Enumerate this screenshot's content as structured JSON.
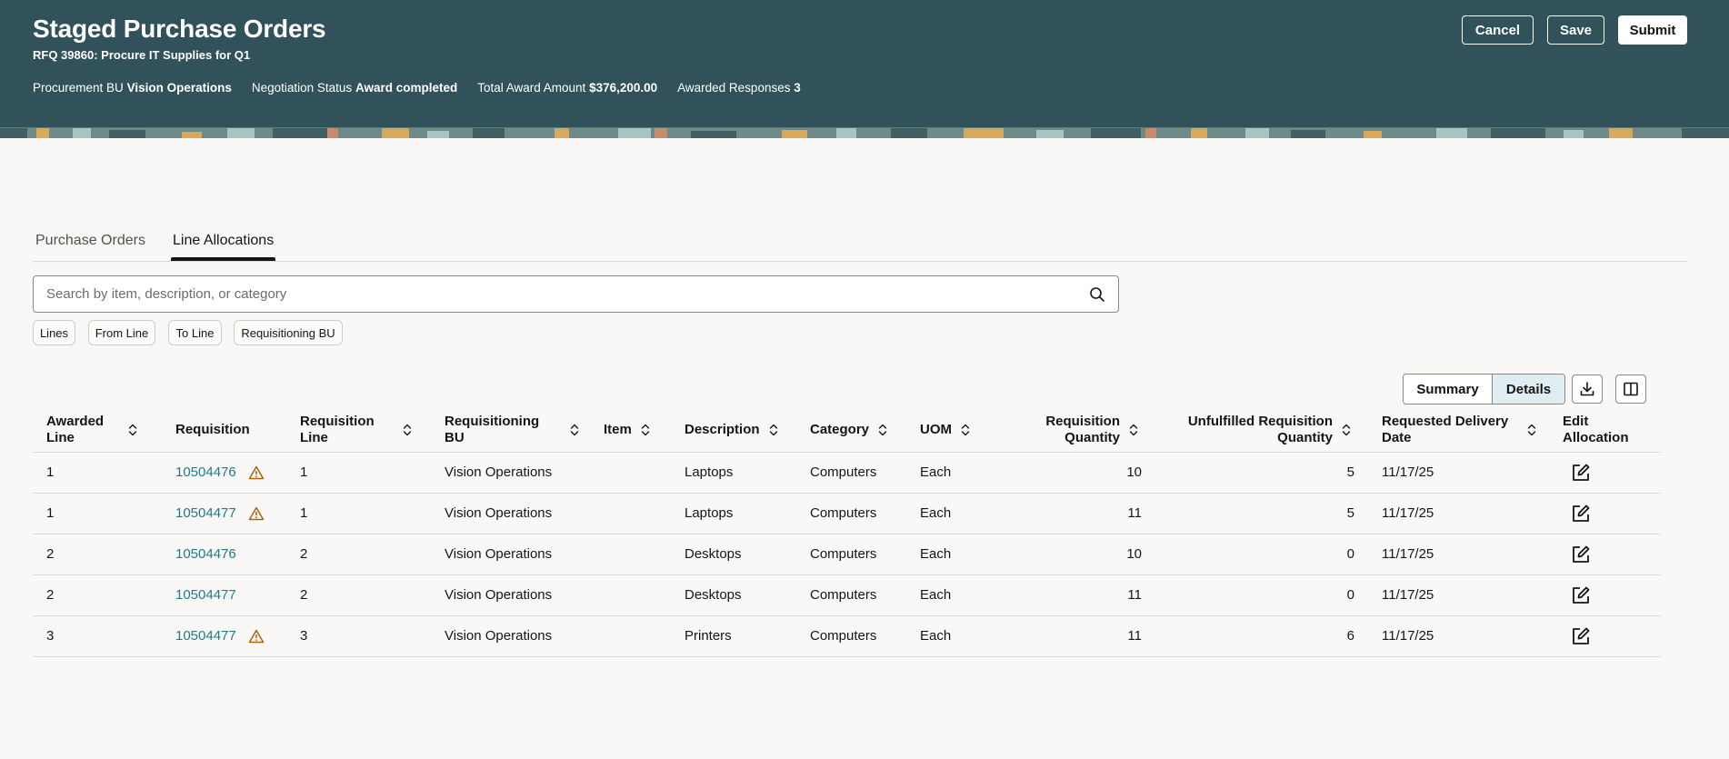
{
  "header": {
    "title": "Staged Purchase Orders",
    "subtitle": "RFQ 39860: Procure IT Supplies for Q1",
    "meta": [
      {
        "label": "Procurement BU",
        "value": "Vision Operations"
      },
      {
        "label": "Negotiation Status",
        "value": "Award completed"
      },
      {
        "label": "Total Award Amount",
        "value": "$376,200.00"
      },
      {
        "label": "Awarded Responses",
        "value": "3"
      }
    ],
    "buttons": {
      "cancel": "Cancel",
      "save": "Save",
      "submit": "Submit"
    }
  },
  "tabs": [
    {
      "label": "Purchase Orders",
      "active": false
    },
    {
      "label": "Line Allocations",
      "active": true
    }
  ],
  "search": {
    "placeholder": "Search by item, description, or category",
    "value": ""
  },
  "filters": [
    "Lines",
    "From Line",
    "To Line",
    "Requisitioning BU"
  ],
  "view_toggle": {
    "summary": "Summary",
    "details": "Details",
    "selected": "Details"
  },
  "toolbar_icons": [
    "download-icon",
    "columns-icon"
  ],
  "table": {
    "columns": [
      {
        "key": "awarded_line",
        "label": "Awarded Line",
        "sortable": true
      },
      {
        "key": "requisition",
        "label": "Requisition",
        "sortable": false
      },
      {
        "key": "requisition_line",
        "label": "Requisition Line",
        "sortable": true
      },
      {
        "key": "requisitioning_bu",
        "label": "Requisitioning BU",
        "sortable": true
      },
      {
        "key": "item",
        "label": "Item",
        "sortable": true
      },
      {
        "key": "description",
        "label": "Description",
        "sortable": true
      },
      {
        "key": "category",
        "label": "Category",
        "sortable": true
      },
      {
        "key": "uom",
        "label": "UOM",
        "sortable": true
      },
      {
        "key": "requisition_quantity",
        "label": "Requisition Quantity",
        "sortable": true
      },
      {
        "key": "unfulfilled_quantity",
        "label": "Unfulfilled Requisition Quantity",
        "sortable": true
      },
      {
        "key": "requested_delivery_date",
        "label": "Requested Delivery Date",
        "sortable": true
      },
      {
        "key": "edit_allocation",
        "label": "Edit Allocation",
        "sortable": false
      }
    ],
    "rows": [
      {
        "awarded_line": "1",
        "requisition": "10504476",
        "warning": true,
        "requisition_line": "1",
        "requisitioning_bu": "Vision Operations",
        "item": "",
        "description": "Laptops",
        "category": "Computers",
        "uom": "Each",
        "requisition_quantity": "10",
        "unfulfilled_quantity": "5",
        "requested_delivery_date": "11/17/25"
      },
      {
        "awarded_line": "1",
        "requisition": "10504477",
        "warning": true,
        "requisition_line": "1",
        "requisitioning_bu": "Vision Operations",
        "item": "",
        "description": "Laptops",
        "category": "Computers",
        "uom": "Each",
        "requisition_quantity": "11",
        "unfulfilled_quantity": "5",
        "requested_delivery_date": "11/17/25"
      },
      {
        "awarded_line": "2",
        "requisition": "10504476",
        "warning": false,
        "requisition_line": "2",
        "requisitioning_bu": "Vision Operations",
        "item": "",
        "description": "Desktops",
        "category": "Computers",
        "uom": "Each",
        "requisition_quantity": "10",
        "unfulfilled_quantity": "0",
        "requested_delivery_date": "11/17/25"
      },
      {
        "awarded_line": "2",
        "requisition": "10504477",
        "warning": false,
        "requisition_line": "2",
        "requisitioning_bu": "Vision Operations",
        "item": "",
        "description": "Desktops",
        "category": "Computers",
        "uom": "Each",
        "requisition_quantity": "11",
        "unfulfilled_quantity": "0",
        "requested_delivery_date": "11/17/25"
      },
      {
        "awarded_line": "3",
        "requisition": "10504477",
        "warning": true,
        "requisition_line": "3",
        "requisitioning_bu": "Vision Operations",
        "item": "",
        "description": "Printers",
        "category": "Computers",
        "uom": "Each",
        "requisition_quantity": "11",
        "unfulfilled_quantity": "6",
        "requested_delivery_date": "11/17/25"
      }
    ]
  },
  "colors": {
    "header_bg": "#31525a",
    "link": "#227a8c",
    "warning": "#ac630c",
    "selected_toggle": "#e0eef3"
  }
}
